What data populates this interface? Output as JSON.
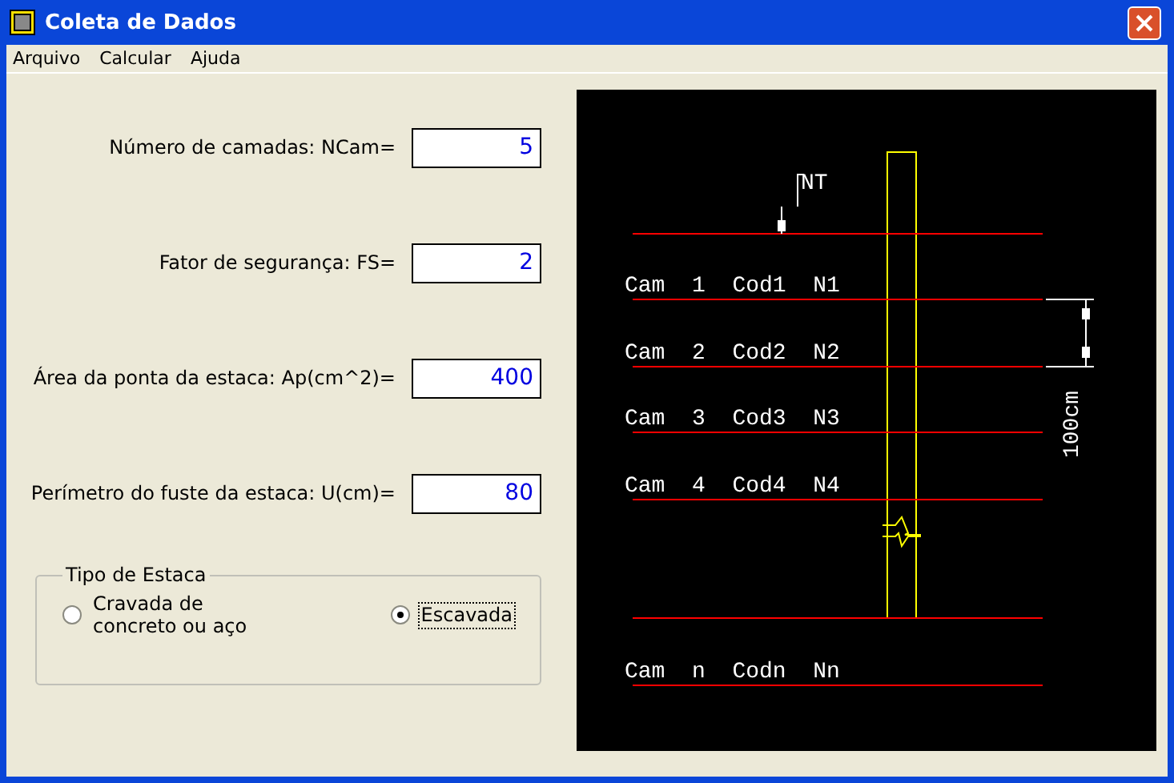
{
  "window": {
    "title": "Coleta de Dados"
  },
  "menu": [
    {
      "label": "Arquivo"
    },
    {
      "label": "Calcular"
    },
    {
      "label": "Ajuda"
    }
  ],
  "fields": [
    {
      "label": "Número de camadas: NCam=",
      "value": "5"
    },
    {
      "label": "Fator de segurança: FS=",
      "value": "2"
    },
    {
      "label": "Área da ponta da estaca: Ap(cm^2)=",
      "value": "400"
    },
    {
      "label": "Perímetro do fuste da estaca: U(cm)=",
      "value": "80"
    }
  ],
  "pile_type": {
    "title": "Tipo de Estaca",
    "options": [
      {
        "label": "Cravada de\nconcreto ou aço",
        "selected": false
      },
      {
        "label": "Escavada",
        "selected": true
      }
    ]
  },
  "drawing": {
    "ground_label": "NT",
    "dimension_label": "100cm",
    "layers": [
      {
        "label": "Cam  1  Cod1  N1"
      },
      {
        "label": "Cam  2  Cod2  N2"
      },
      {
        "label": "Cam  3  Cod3  N3"
      },
      {
        "label": "Cam  4  Cod4  N4"
      }
    ],
    "last_layer": "Cam  n  Codn  Nn"
  }
}
